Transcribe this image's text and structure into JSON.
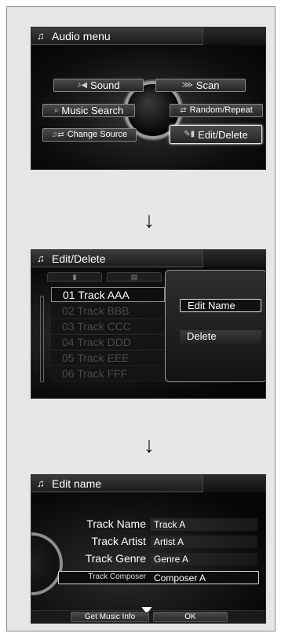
{
  "audio_menu": {
    "title": "Audio menu",
    "buttons": {
      "sound": "Sound",
      "scan": "Scan",
      "music_search": "Music Search",
      "random_repeat": "Random/Repeat",
      "change_source": "Change Source",
      "edit_delete": "Edit/Delete"
    }
  },
  "edit_delete": {
    "title": "Edit/Delete",
    "tracks": [
      "01 Track AAA",
      "02 Track BBB",
      "03 Track CCC",
      "04 Track DDD",
      "05 Track EEE",
      "06 Track FFF"
    ],
    "popup": {
      "edit_name": "Edit Name",
      "delete": "Delete"
    }
  },
  "edit_name": {
    "title": "Edit name",
    "rows": [
      {
        "label": "Track Name",
        "value": "Track A"
      },
      {
        "label": "Track Artist",
        "value": "Artist A"
      },
      {
        "label": "Track Genre",
        "value": "Genre A"
      },
      {
        "label": "Track Composer",
        "value": "Composer A"
      }
    ],
    "bottom": {
      "get_music_info": "Get Music Info",
      "ok": "OK"
    }
  },
  "arrows": [
    "↓",
    "↓"
  ]
}
